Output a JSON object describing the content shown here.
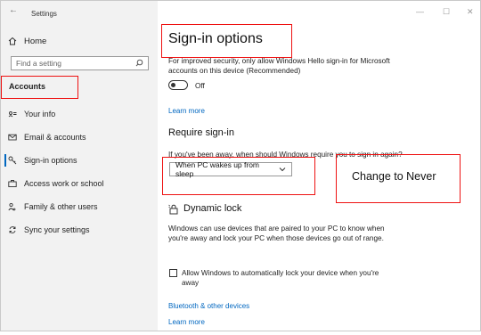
{
  "window": {
    "title": "Settings",
    "controls": {
      "minimize": "—",
      "maximize": "☐",
      "close": "✕"
    }
  },
  "sidebar": {
    "home_label": "Home",
    "search_placeholder": "Find a setting",
    "category_label": "Accounts",
    "items": [
      {
        "label": "Your info",
        "icon": "person-card-icon"
      },
      {
        "label": "Email & accounts",
        "icon": "mail-icon"
      },
      {
        "label": "Sign-in options",
        "icon": "key-icon"
      },
      {
        "label": "Access work or school",
        "icon": "briefcase-icon"
      },
      {
        "label": "Family & other users",
        "icon": "people-icon"
      },
      {
        "label": "Sync your settings",
        "icon": "sync-icon"
      }
    ]
  },
  "main": {
    "page_title": "Sign-in options",
    "hello_text": "For improved security, only allow Windows Hello sign-in for Microsoft accounts on this device (Recommended)",
    "toggle_state_label": "Off",
    "learn_more_1": "Learn more",
    "require_signin_title": "Require sign-in",
    "require_signin_question": "If you've been away, when should Windows require you to sign in again?",
    "dropdown_value": "When PC wakes up from sleep",
    "dynamic_lock_title": "Dynamic lock",
    "dynamic_lock_desc": "Windows can use devices that are paired to your PC to know when you're away and lock your PC when those devices go out of range.",
    "checkbox_label": "Allow Windows to automatically lock your device when you're away",
    "bluetooth_link": "Bluetooth & other devices",
    "learn_more_2": "Learn more"
  },
  "annotation": {
    "note": "Change to Never",
    "box_color": "#e11111"
  },
  "colors": {
    "accent": "#0067c0",
    "sidebar_bg": "#f2f2f2"
  }
}
